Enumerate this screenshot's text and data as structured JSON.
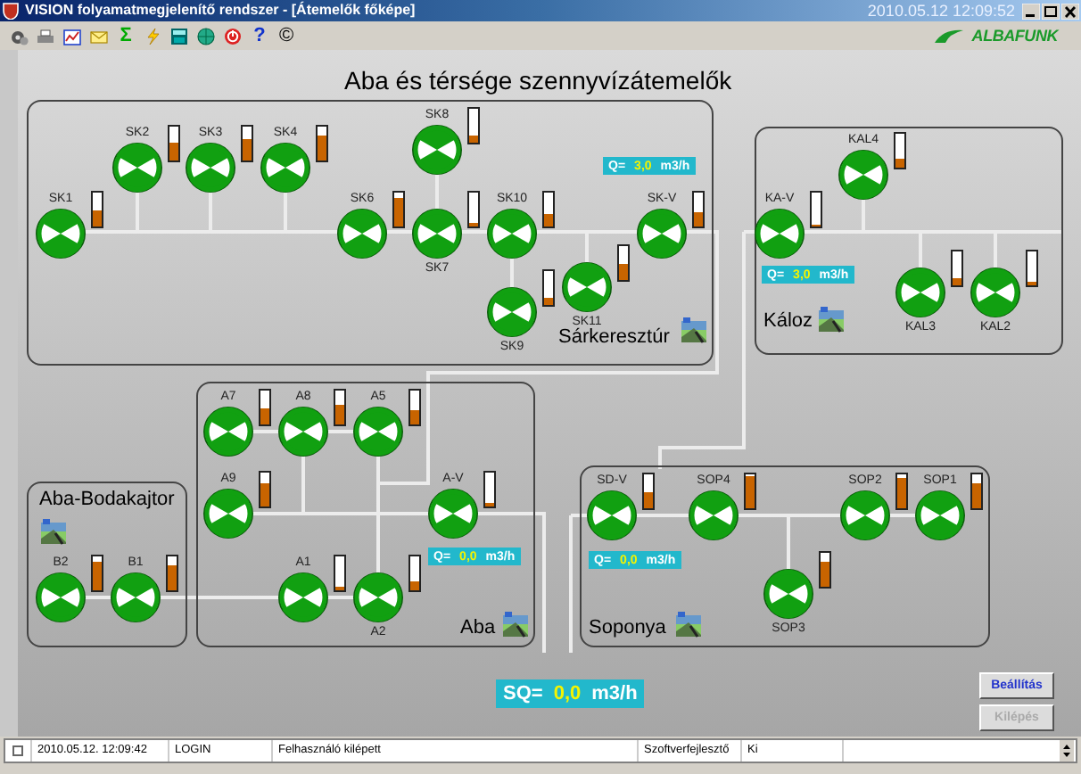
{
  "window": {
    "title": "VISION folyamatmegjelenítő rendszer - [Átemelők főképe]",
    "clock": "2010.05.12 12:09:52"
  },
  "toolbar": {
    "glyphs": [
      "Σ",
      "?",
      "©"
    ]
  },
  "logo": {
    "text": "ALBAFUNK"
  },
  "page_title": "Aba és térsége szennyvízátemelők",
  "groups": [
    {
      "name": "Sárkeresztúr",
      "flow": {
        "label": "Q=",
        "value": "3,0",
        "unit": "m3/h"
      },
      "pumps": [
        {
          "label": "SK1",
          "level": 0.5
        },
        {
          "label": "SK2",
          "level": 0.55
        },
        {
          "label": "SK3",
          "level": 0.65
        },
        {
          "label": "SK4",
          "level": 0.75
        },
        {
          "label": "SK6",
          "level": 0.85
        },
        {
          "label": "SK8",
          "level": 0.2
        },
        {
          "label": "SK7",
          "level": 0.1
        },
        {
          "label": "SK10",
          "level": 0.35
        },
        {
          "label": "SK9",
          "level": 0.2
        },
        {
          "label": "SK11",
          "level": 0.45
        },
        {
          "label": "SK-V",
          "level": 0.4
        }
      ]
    },
    {
      "name": "Káloz",
      "flow": {
        "label": "Q=",
        "value": "3,0",
        "unit": "m3/h"
      },
      "pumps": [
        {
          "label": "KAL4",
          "level": 0.25
        },
        {
          "label": "KA-V",
          "level": 0.05
        },
        {
          "label": "KAL3",
          "level": 0.2
        },
        {
          "label": "KAL2",
          "level": 0.1
        }
      ]
    },
    {
      "name": "Aba-Bodakajtor",
      "pumps": [
        {
          "label": "B2",
          "level": 0.85
        },
        {
          "label": "B1",
          "level": 0.75
        }
      ]
    },
    {
      "name": "Aba",
      "flow": {
        "label": "Q=",
        "value": "0,0",
        "unit": "m3/h"
      },
      "pumps": [
        {
          "label": "A7",
          "level": 0.45
        },
        {
          "label": "A8",
          "level": 0.6
        },
        {
          "label": "A5",
          "level": 0.4
        },
        {
          "label": "A9",
          "level": 0.7
        },
        {
          "label": "A-V",
          "level": 0.1
        },
        {
          "label": "A1",
          "level": 0.1
        },
        {
          "label": "A2",
          "level": 0.25
        }
      ]
    },
    {
      "name": "Soponya",
      "flow": {
        "label": "Q=",
        "value": "0,0",
        "unit": "m3/h"
      },
      "pumps": [
        {
          "label": "SD-V",
          "level": 0.5
        },
        {
          "label": "SOP4",
          "level": 0.95
        },
        {
          "label": "SOP2",
          "level": 0.9
        },
        {
          "label": "SOP1",
          "level": 0.75
        },
        {
          "label": "SOP3",
          "level": 0.75
        }
      ]
    }
  ],
  "total_flow": {
    "label": "SQ=",
    "value": "0,0",
    "unit": "m3/h"
  },
  "buttons": [
    {
      "label": "Beállítás",
      "disabled": false
    },
    {
      "label": "Kilépés",
      "disabled": true
    }
  ],
  "status_bar": {
    "checked": false,
    "cells": [
      "2010.05.12. 12:09:42",
      "LOGIN",
      "Felhasználó kilépett",
      "Szoftverfejlesztő",
      "Ki"
    ]
  }
}
